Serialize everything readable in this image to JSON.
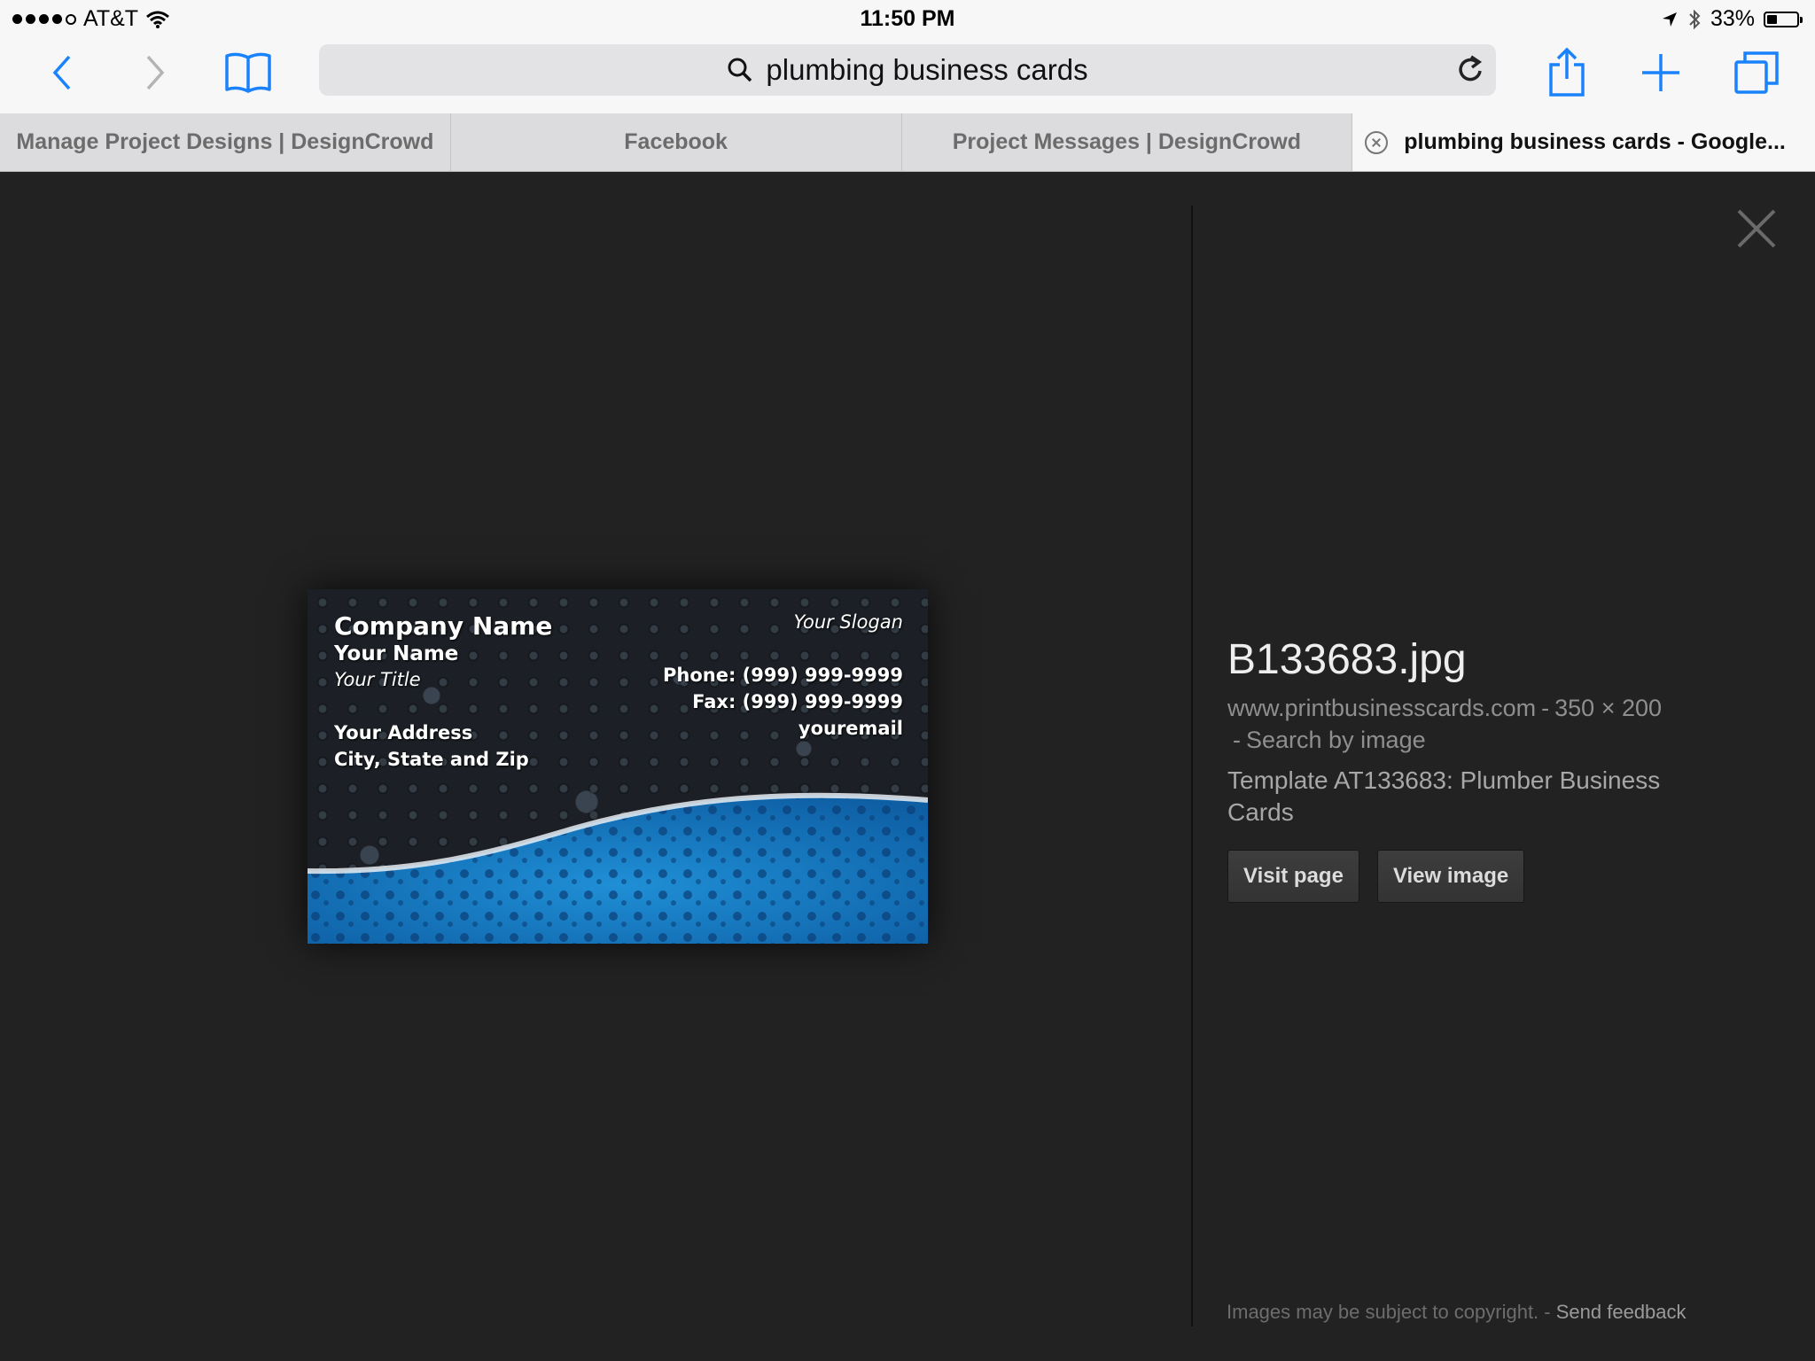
{
  "status_bar": {
    "carrier": "AT&T",
    "time": "11:50 PM",
    "battery": "33%",
    "signal_bars_filled": 4,
    "signal_bars_total": 5
  },
  "toolbar": {
    "search_query": "plumbing business cards",
    "accent_color": "#1a82fb"
  },
  "tabs": [
    {
      "label": "Manage Project Designs | DesignCrowd"
    },
    {
      "label": "Facebook"
    },
    {
      "label": "Project Messages | DesignCrowd"
    },
    {
      "label": "plumbing business cards - Google..."
    }
  ],
  "card": {
    "company": "Company Name",
    "name": "Your Name",
    "title": "Your Title",
    "address": "Your Address",
    "city": "City, State and Zip",
    "slogan": "Your Slogan",
    "phone": "Phone: (999) 999-9999",
    "fax": "Fax: (999) 999-9999",
    "email": "youremail"
  },
  "image_info": {
    "filename": "B133683.jpg",
    "source": "www.printbusinesscards.com",
    "separator": "-",
    "dimensions": "350 × 200",
    "search_by_image": "Search by image",
    "description": "Template AT133683: Plumber Business Cards",
    "visit_page": "Visit page",
    "view_image": "View image"
  },
  "footer": {
    "copyright": "Images may be subject to copyright.",
    "separator": "-",
    "send_feedback": "Send feedback"
  }
}
